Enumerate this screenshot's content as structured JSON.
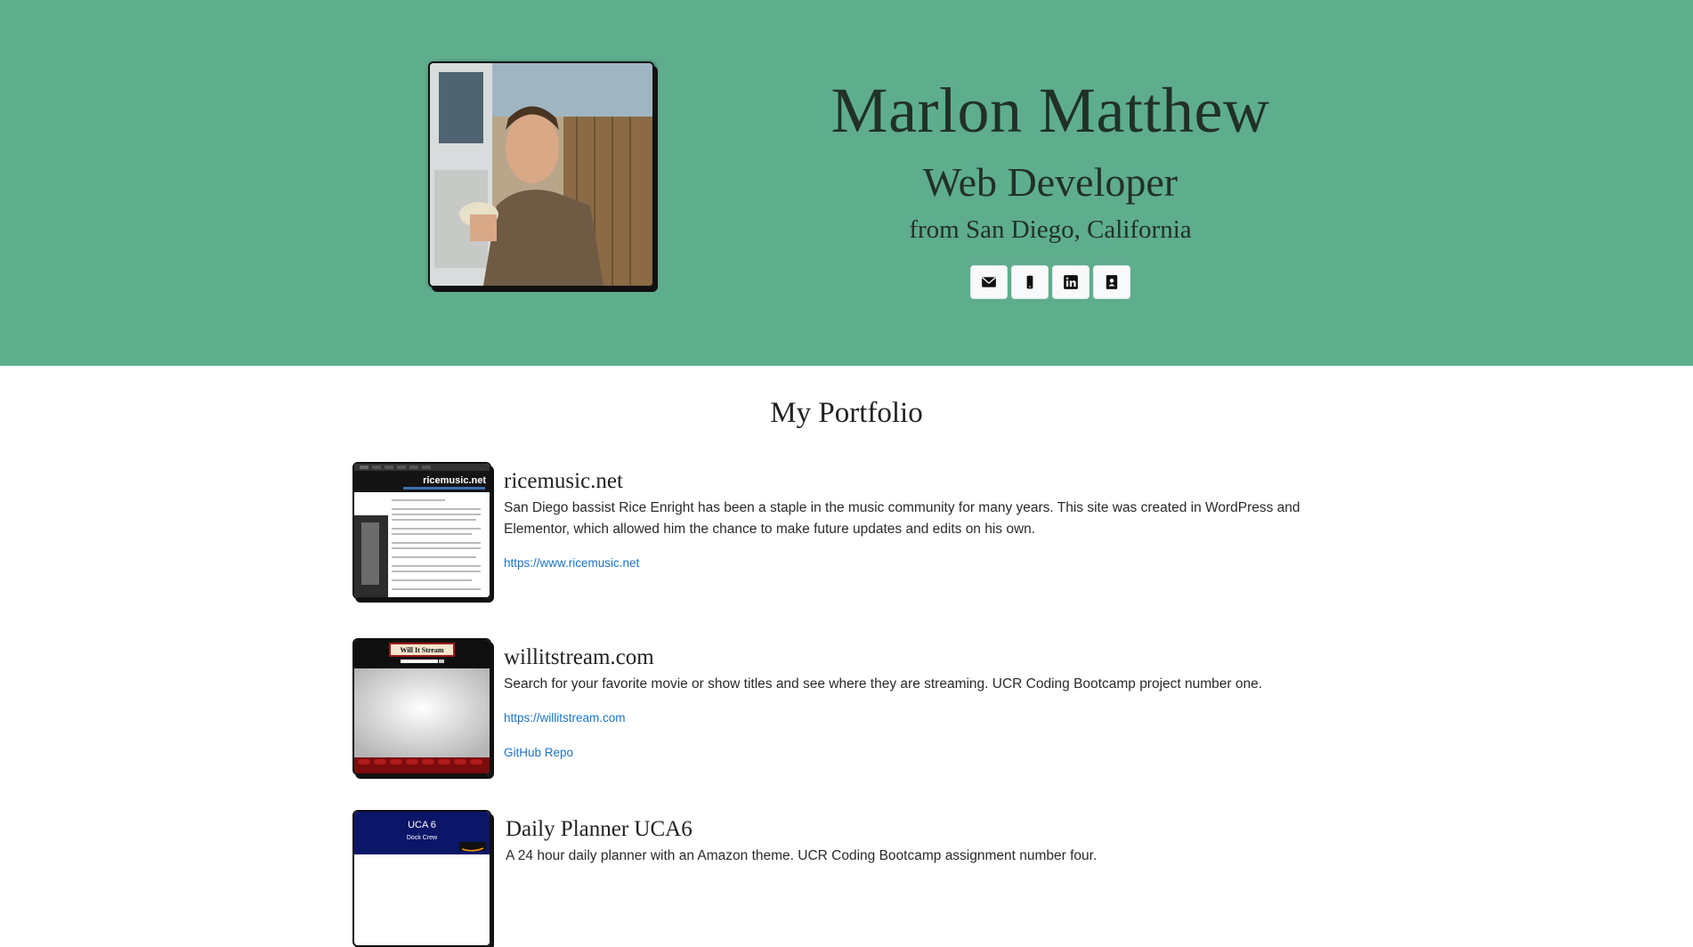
{
  "header": {
    "name": "Marlon Matthew",
    "role": "Web Developer",
    "location": "from San Diego, California",
    "contacts": [
      {
        "icon": "envelope-icon"
      },
      {
        "icon": "mobile-phone-icon"
      },
      {
        "icon": "linkedin-icon"
      },
      {
        "icon": "contact-card-icon"
      }
    ],
    "background_color": "#5eae8e"
  },
  "portfolio": {
    "title": "My Portfolio",
    "projects": [
      {
        "title": "ricemusic.net",
        "description": "San Diego bassist Rice Enright has been a staple in the music community for many years. This site was created in WordPress and Elementor, which allowed him the chance to make future updates and edits on his own.",
        "links": [
          "https://www.ricemusic.net"
        ],
        "thumb_text": "ricemusic.net"
      },
      {
        "title": "willitstream.com",
        "description": "Search for your favorite movie or show titles and see where they are streaming. UCR Coding Bootcamp project number one.",
        "links": [
          "https://willitstream.com",
          "GitHub Repo"
        ],
        "thumb_text": "Will It Stream"
      },
      {
        "title": "Daily Planner UCA6",
        "description": "A 24 hour daily planner with an Amazon theme. UCR Coding Bootcamp assignment number four.",
        "links": [],
        "thumb_text": "UCA 6",
        "thumb_subtext": "Dock Crew"
      }
    ]
  },
  "link_color": "#1a73c8"
}
